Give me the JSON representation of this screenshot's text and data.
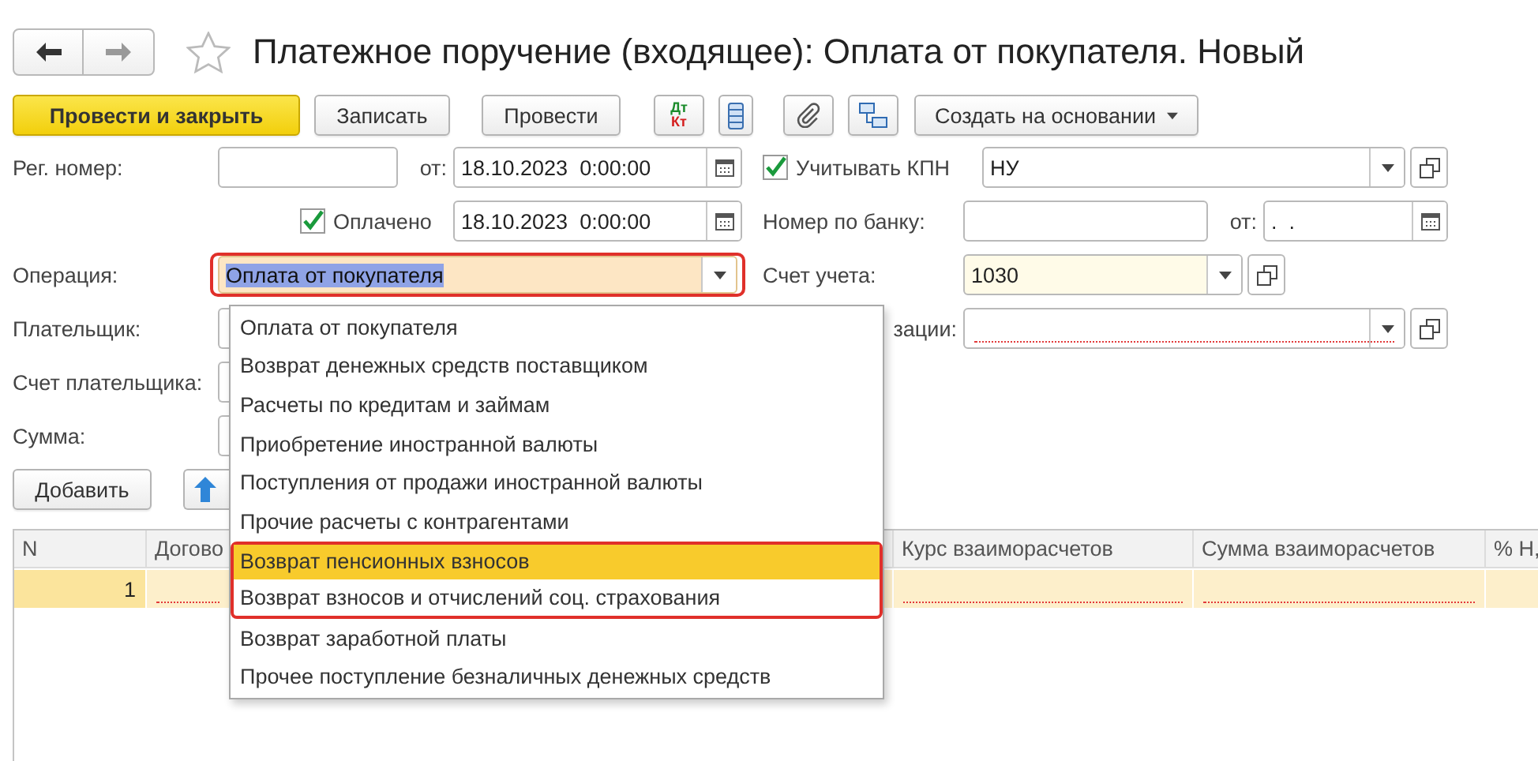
{
  "title": "Платежное поручение (входящее): Оплата от покупателя. Новый",
  "toolbar": [
    {
      "kind": "primary",
      "label": "Провести и закрыть"
    },
    {
      "kind": "plain",
      "label": "Записать"
    },
    {
      "kind": "plain",
      "label": "Провести"
    },
    {
      "kind": "dtkt",
      "top": "Дт",
      "bottom": "Кт"
    },
    {
      "kind": "list"
    },
    {
      "kind": "clip"
    },
    {
      "kind": "structure"
    },
    {
      "kind": "menu",
      "label": "Создать на основании"
    }
  ],
  "form": {
    "reg_number": {
      "label": "Рег. номер:"
    },
    "date": {
      "label": "от:",
      "value": "18.10.2023  0:00:00"
    },
    "kpn": {
      "label": "Учитывать КПН",
      "checked": true
    },
    "kpn_type": {
      "value": "НУ"
    },
    "paid": {
      "label": "Оплачено",
      "checked": true
    },
    "paid_date": {
      "value": "18.10.2023  0:00:00"
    },
    "bank_number": {
      "label": "Номер по банку:"
    },
    "bank_date": {
      "label": "от:",
      "value": ".  ."
    },
    "operation": {
      "label": "Операция:",
      "value": "Оплата от покупателя",
      "outlined": true
    },
    "account": {
      "label": "Счет учета:",
      "value": "1030"
    },
    "payer": {
      "label": "Плательщик:"
    },
    "org_account": {
      "label": "зации:",
      "required": true
    },
    "payer_account": {
      "label": "Счет плательщика:"
    },
    "amount": {
      "label": "Сумма:"
    }
  },
  "add_button": "Добавить",
  "table": {
    "columns": [
      {
        "label": "N",
        "required": false
      },
      {
        "label": "Догово",
        "required": true
      },
      {
        "label": "Курс взаиморасчетов",
        "required": true
      },
      {
        "label": "Сумма взаиморасчетов",
        "required": true
      },
      {
        "label": "% Н,",
        "required": false
      }
    ],
    "rows": [
      {
        "n": "1",
        "selected": true
      }
    ]
  },
  "dropdown": {
    "items": [
      {
        "label": "Оплата от покупателя",
        "selected": false,
        "outlined": false
      },
      {
        "label": "Возврат денежных средств поставщиком",
        "selected": false,
        "outlined": false
      },
      {
        "label": "Расчеты по кредитам и займам",
        "selected": false,
        "outlined": false
      },
      {
        "label": "Приобретение иностранной валюты",
        "selected": false,
        "outlined": false
      },
      {
        "label": "Поступления от продажи иностранной валюты",
        "selected": false,
        "outlined": false
      },
      {
        "label": "Прочие расчеты с контрагентами",
        "selected": false,
        "outlined": false
      },
      {
        "label": "Возврат пенсионных взносов",
        "selected": true,
        "outlined": true
      },
      {
        "label": "Возврат взносов и отчислений соц. страхования",
        "selected": false,
        "outlined": true
      },
      {
        "label": "Возврат заработной платы",
        "selected": false,
        "outlined": false
      },
      {
        "label": "Прочее поступление безналичных денежных средств",
        "selected": false,
        "outlined": false
      }
    ]
  }
}
